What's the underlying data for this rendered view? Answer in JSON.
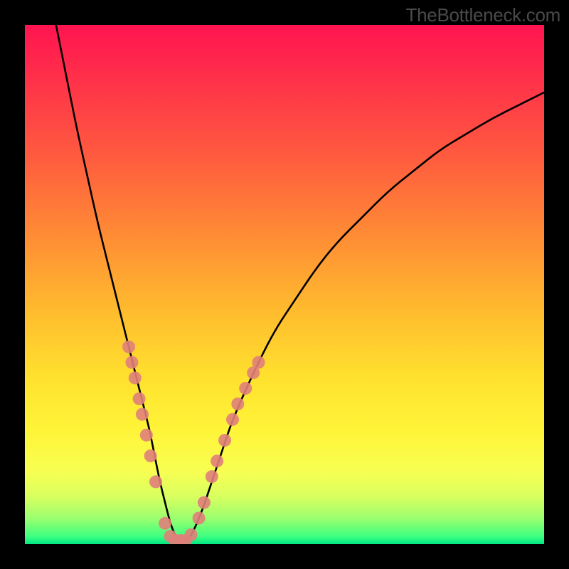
{
  "watermark": "TheBottleneck.com",
  "colors": {
    "frame": "#000000",
    "curve_stroke": "#000000",
    "marker_fill": "#e07f7a",
    "gradient_stops": [
      {
        "offset": 0.0,
        "color": "#ff1450"
      },
      {
        "offset": 0.1,
        "color": "#ff2f4a"
      },
      {
        "offset": 0.25,
        "color": "#ff5a3f"
      },
      {
        "offset": 0.4,
        "color": "#ff8a35"
      },
      {
        "offset": 0.55,
        "color": "#ffbb2e"
      },
      {
        "offset": 0.68,
        "color": "#ffe12e"
      },
      {
        "offset": 0.78,
        "color": "#fff438"
      },
      {
        "offset": 0.86,
        "color": "#f8ff52"
      },
      {
        "offset": 0.91,
        "color": "#d7ff60"
      },
      {
        "offset": 0.95,
        "color": "#9cff6e"
      },
      {
        "offset": 0.985,
        "color": "#3eff80"
      },
      {
        "offset": 1.0,
        "color": "#00e884"
      }
    ]
  },
  "chart_data": {
    "type": "line",
    "title": "",
    "xlabel": "",
    "ylabel": "",
    "xlim": [
      0,
      100
    ],
    "ylim": [
      0,
      100
    ],
    "series": [
      {
        "name": "bottleneck-curve",
        "x": [
          6,
          8,
          10,
          12,
          14,
          16,
          18,
          20,
          21,
          22,
          23,
          24,
          25,
          26,
          27,
          28,
          29,
          30,
          31,
          32,
          34,
          36,
          38,
          40,
          44,
          48,
          52,
          56,
          60,
          65,
          70,
          75,
          80,
          85,
          90,
          95,
          100
        ],
        "y": [
          100,
          90,
          80,
          71,
          62,
          54,
          46,
          38,
          34,
          30,
          26,
          22,
          17,
          12,
          8,
          4,
          1.5,
          0.7,
          0.7,
          1.5,
          6,
          12,
          18,
          24,
          33,
          41,
          47,
          53,
          58,
          63,
          68,
          72,
          76,
          79,
          82,
          84.5,
          87
        ]
      }
    ],
    "markers": [
      {
        "x": 20.0,
        "y": 38
      },
      {
        "x": 20.6,
        "y": 35
      },
      {
        "x": 21.2,
        "y": 32
      },
      {
        "x": 22.0,
        "y": 28
      },
      {
        "x": 22.6,
        "y": 25
      },
      {
        "x": 23.4,
        "y": 21
      },
      {
        "x": 24.2,
        "y": 17
      },
      {
        "x": 25.2,
        "y": 12
      },
      {
        "x": 27.0,
        "y": 4
      },
      {
        "x": 28.0,
        "y": 1.5
      },
      {
        "x": 29.0,
        "y": 0.7
      },
      {
        "x": 30.0,
        "y": 0.7
      },
      {
        "x": 31.0,
        "y": 0.7
      },
      {
        "x": 32.0,
        "y": 1.8
      },
      {
        "x": 33.5,
        "y": 5
      },
      {
        "x": 34.5,
        "y": 8
      },
      {
        "x": 36.0,
        "y": 13
      },
      {
        "x": 37.0,
        "y": 16
      },
      {
        "x": 38.5,
        "y": 20
      },
      {
        "x": 40.0,
        "y": 24
      },
      {
        "x": 41.0,
        "y": 27
      },
      {
        "x": 42.5,
        "y": 30
      },
      {
        "x": 44.0,
        "y": 33
      },
      {
        "x": 45.0,
        "y": 35
      }
    ]
  }
}
